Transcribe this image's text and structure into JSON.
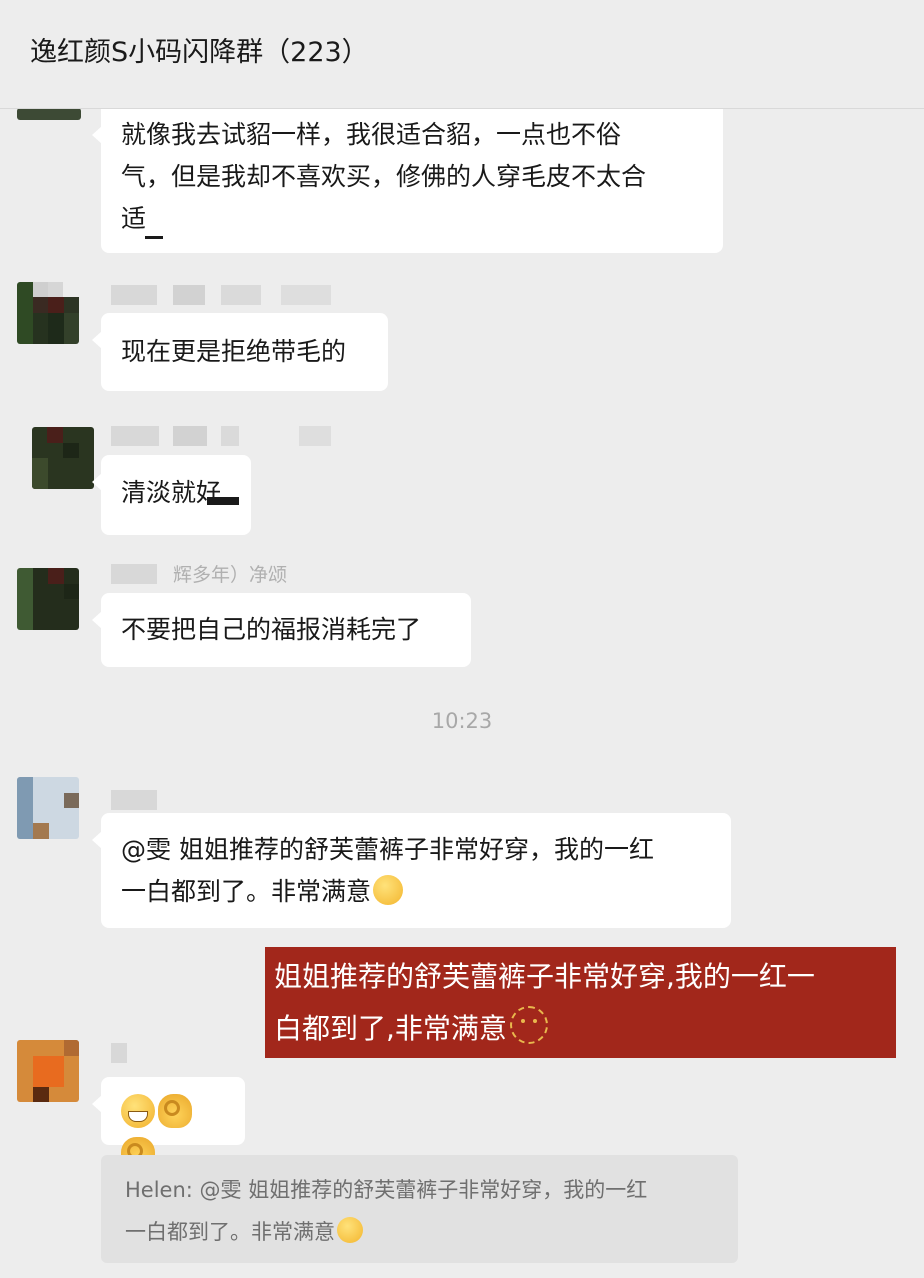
{
  "header": {
    "title": "逸红颜S小码闪降群（223）"
  },
  "messages": [
    {
      "lines": [
        "就像我去试貂一样，我很适合貂，一点也不俗",
        "气，但是我却不喜欢买，修佛的人穿毛皮不太合",
        "适"
      ]
    },
    {
      "lines": [
        "现在更是拒绝带毛的"
      ]
    },
    {
      "lines": [
        "清淡就好"
      ]
    },
    {
      "sender_partial": "辉多年）净颂",
      "lines": [
        "不要把自己的福报消耗完了"
      ]
    },
    {
      "lines": [
        "@雯 姐姐推荐的舒芙蕾裤子非常好穿，我的一红",
        "一白都到了。非常满意"
      ],
      "emoji": "thinking-face-emoji"
    },
    {
      "emojis": [
        "grinning-face-emoji",
        "ok-hand-emoji",
        "ok-hand-emoji"
      ]
    }
  ],
  "timestamp": "10:23",
  "overlay_caption": {
    "lines": [
      "姐姐推荐的舒芙蕾裤子非常好穿,我的一红一",
      "白都到了,非常满意"
    ],
    "emoji": "slight-smile-outline-emoji"
  },
  "quote": {
    "lines": [
      "Helen: @雯 姐姐推荐的舒芙蕾裤子非常好穿，我的一红",
      "一白都到了。非常满意"
    ],
    "emoji": "thinking-face-emoji"
  },
  "colors": {
    "background": "#ededed",
    "bubble": "#ffffff",
    "overlay": "#a2271b",
    "quote": "#e1e1e1",
    "time": "#a8a8a8"
  }
}
